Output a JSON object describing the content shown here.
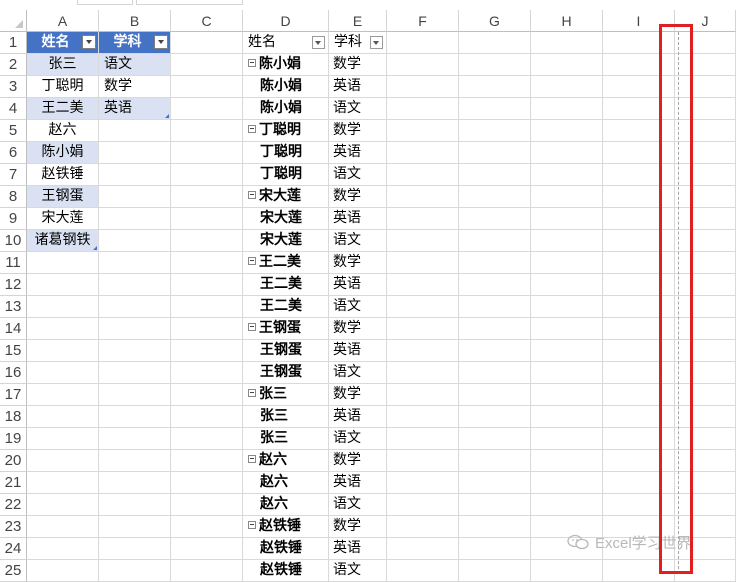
{
  "columns": [
    "A",
    "B",
    "C",
    "D",
    "E",
    "F",
    "G",
    "H",
    "I",
    "J"
  ],
  "rows": [
    "1",
    "2",
    "3",
    "4",
    "5",
    "6",
    "7",
    "8",
    "9",
    "10",
    "11",
    "12",
    "13",
    "14",
    "15",
    "16",
    "17",
    "18",
    "19",
    "20",
    "21",
    "22",
    "23",
    "24",
    "25"
  ],
  "table1": {
    "headers": [
      "姓名",
      "学科"
    ],
    "names": [
      "张三",
      "丁聪明",
      "王二美",
      "赵六",
      "陈小娟",
      "赵铁锤",
      "王钢蛋",
      "宋大莲",
      "诸葛钢铁"
    ],
    "subjects": [
      "语文",
      "数学",
      "英语"
    ]
  },
  "pivot": {
    "headers": [
      "姓名",
      "学科"
    ],
    "groups": [
      {
        "name": "陈小娟",
        "subjects": [
          "数学",
          "英语",
          "语文"
        ]
      },
      {
        "name": "丁聪明",
        "subjects": [
          "数学",
          "英语",
          "语文"
        ]
      },
      {
        "name": "宋大莲",
        "subjects": [
          "数学",
          "英语",
          "语文"
        ]
      },
      {
        "name": "王二美",
        "subjects": [
          "数学",
          "英语",
          "语文"
        ]
      },
      {
        "name": "王钢蛋",
        "subjects": [
          "数学",
          "英语",
          "语文"
        ]
      },
      {
        "name": "张三",
        "subjects": [
          "数学",
          "英语",
          "语文"
        ]
      },
      {
        "name": "赵六",
        "subjects": [
          "数学",
          "英语",
          "语文"
        ]
      },
      {
        "name": "赵铁锤",
        "subjects": [
          "数学",
          "英语",
          "语文"
        ]
      }
    ]
  },
  "colors": {
    "header_blue": "#4472c4",
    "band": "#d9e1f2",
    "highlight_red": "#e02020"
  },
  "watermark": {
    "text": "Excel学习世界",
    "icon": "wechat-icon"
  }
}
